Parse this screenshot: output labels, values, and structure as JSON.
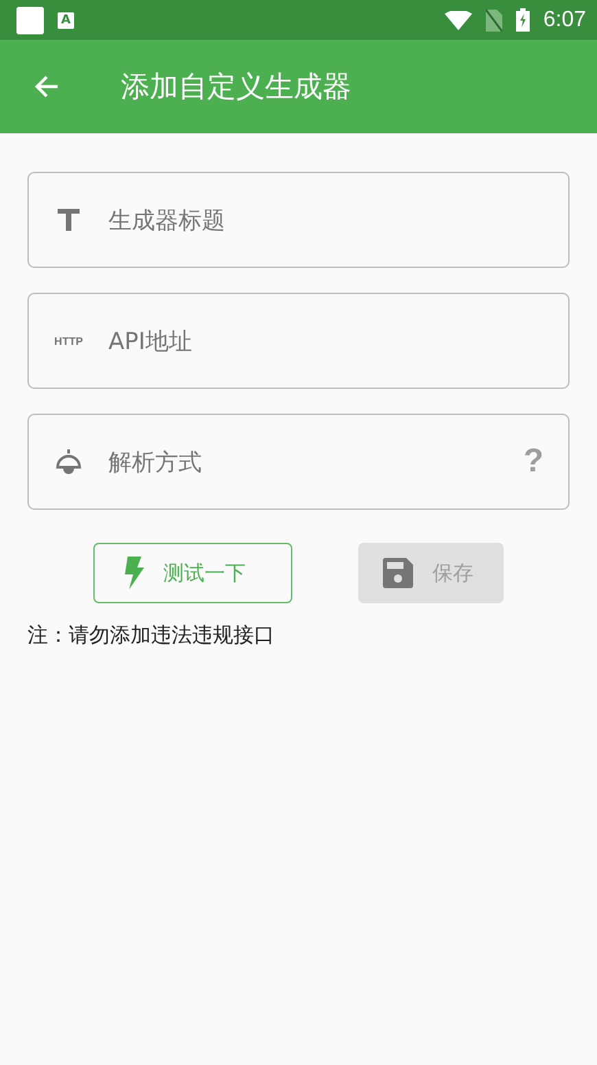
{
  "status_bar": {
    "notification_badge": "A",
    "time": "6:07"
  },
  "app_bar": {
    "title": "添加自定义生成器"
  },
  "fields": [
    {
      "kind": "title",
      "placeholder": "生成器标题"
    },
    {
      "kind": "http",
      "icon_text": "HTTP",
      "placeholder": "API地址"
    },
    {
      "kind": "parser",
      "placeholder": "解析方式",
      "help": "?"
    }
  ],
  "buttons": [
    {
      "kind": "test",
      "label": "测试一下",
      "disabled": false
    },
    {
      "kind": "save",
      "label": "保存",
      "disabled": true
    }
  ],
  "note": "注：请勿添加违法违规接口"
}
